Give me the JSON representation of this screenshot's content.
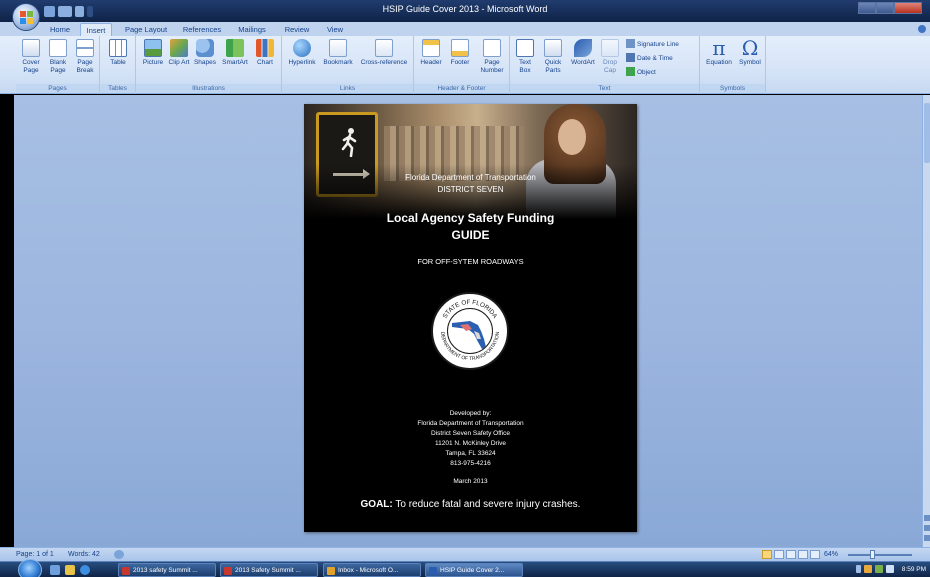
{
  "window": {
    "title": "HSIP Guide Cover 2013 - Microsoft Word"
  },
  "tabs": [
    {
      "label": "Home"
    },
    {
      "label": "Insert",
      "active": true
    },
    {
      "label": "Page Layout"
    },
    {
      "label": "References"
    },
    {
      "label": "Mailings"
    },
    {
      "label": "Review"
    },
    {
      "label": "View"
    }
  ],
  "ribbon": {
    "groups": {
      "pages": "Pages",
      "tables": "Tables",
      "illustrations": "Illustrations",
      "links": "Links",
      "header_footer": "Header & Footer",
      "text": "Text",
      "symbols": "Symbols"
    },
    "buttons": {
      "cover_page": "Cover Page",
      "blank_page": "Blank Page",
      "page_break": "Page Break",
      "table": "Table",
      "picture": "Picture",
      "clip_art": "Clip Art",
      "shapes": "Shapes",
      "smartart": "SmartArt",
      "chart": "Chart",
      "hyperlink": "Hyperlink",
      "bookmark": "Bookmark",
      "cross_reference": "Cross-reference",
      "header": "Header",
      "footer": "Footer",
      "page_number": "Page Number",
      "text_box": "Text Box",
      "quick_parts": "Quick Parts",
      "wordart": "WordArt",
      "drop_cap": "Drop Cap",
      "signature_line": "Signature Line",
      "date_time": "Date & Time",
      "object": "Object",
      "equation": "Equation",
      "symbol": "Symbol"
    }
  },
  "document": {
    "agency": "Florida Department of Transportation",
    "district": "DISTRICT SEVEN",
    "title_line1": "Local Agency Safety Funding",
    "title_line2": "GUIDE",
    "subtitle": "FOR OFF-SYTEM ROADWAYS",
    "seal_top": "STATE OF FLORIDA",
    "seal_bottom": "DEPARTMENT OF TRANSPORTATION",
    "developed_by": "Developed by:",
    "dev_agency": "Florida Department of Transportation",
    "dev_office": "District Seven Safety Office",
    "address": "11201 N. McKinley Drive",
    "city": "Tampa, FL 33624",
    "phone": "813-975-4216",
    "date": "March 2013",
    "goal_label": "GOAL:",
    "goal_text": " To reduce fatal and severe injury crashes."
  },
  "status": {
    "page": "Page: 1 of 1",
    "words": "Words: 42",
    "zoom": "64%"
  },
  "taskbar": {
    "items": [
      {
        "label": "2013 safety Summit ...",
        "icon_color": "#c8372d"
      },
      {
        "label": "2013 Safety Summit ...",
        "icon_color": "#c8372d"
      },
      {
        "label": "Inbox - Microsoft O...",
        "icon_color": "#e0a22a"
      },
      {
        "label": "HSIP Guide Cover 2...",
        "icon_color": "#2a5db0"
      }
    ],
    "clock": "8:59 PM"
  },
  "colors": {
    "accent": "#15428b",
    "ribbon_bg": "#d6e4f7",
    "workspace": "#9cb6df"
  }
}
